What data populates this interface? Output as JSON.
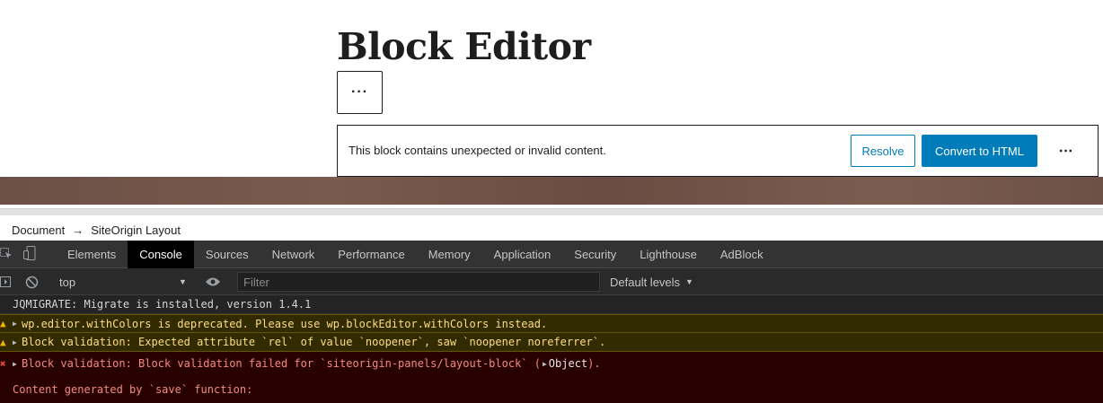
{
  "editor": {
    "title": "Block Editor",
    "block_toggle": "···",
    "warning": {
      "text": "This block contains unexpected or invalid content.",
      "resolve_label": "Resolve",
      "convert_label": "Convert to HTML",
      "more_label": "⋯"
    }
  },
  "breadcrumb": {
    "items": [
      "Document",
      "SiteOrigin Layout"
    ],
    "separator": "→"
  },
  "devtools": {
    "tabs": [
      "Elements",
      "Console",
      "Sources",
      "Network",
      "Performance",
      "Memory",
      "Application",
      "Security",
      "Lighthouse",
      "AdBlock"
    ],
    "active_tab": "Console",
    "toolbar": {
      "context": "top",
      "filter_placeholder": "Filter",
      "levels": "Default levels"
    },
    "messages": [
      {
        "level": "info",
        "text": "JQMIGRATE: Migrate is installed, version 1.4.1"
      },
      {
        "level": "warning",
        "text": "wp.editor.withColors is deprecated. Please use wp.blockEditor.withColors instead."
      },
      {
        "level": "warning",
        "text": "Block validation: Expected attribute `rel` of value `noopener`, saw `noopener noreferrer`."
      },
      {
        "level": "error",
        "text": "Block validation: Block validation failed for `siteorigin-panels/layout-block` (",
        "object": "Object",
        "suffix": ")."
      },
      {
        "level": "error",
        "text": "Content generated by `save` function:"
      }
    ]
  },
  "colors": {
    "accent": "#007cba",
    "warning_bg": "#332b00",
    "error_bg": "#290000"
  }
}
